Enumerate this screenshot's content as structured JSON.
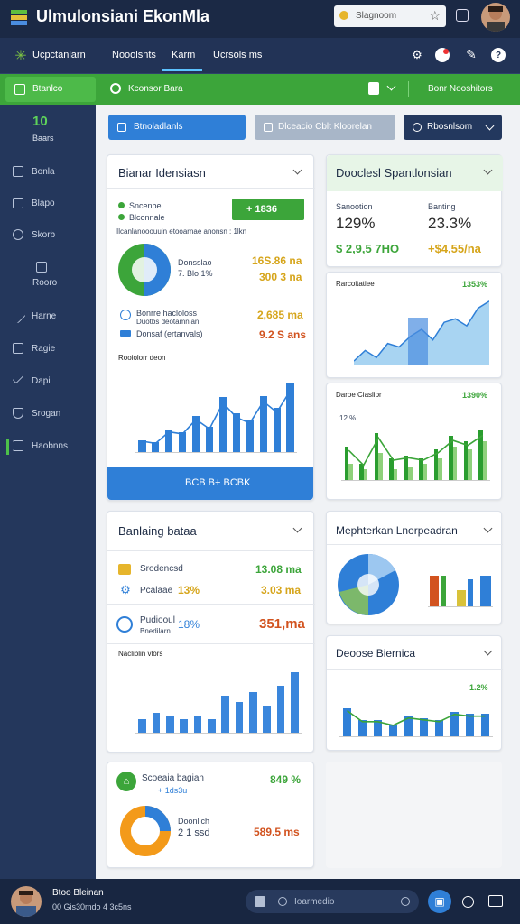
{
  "app": {
    "title": "Ulmulonsiani EkonMla",
    "search_text": "Slagnoom",
    "nav_tabs": [
      "Ucpctanlarn",
      "Nooolsnts",
      "Karm",
      "Ucrsols ms"
    ]
  },
  "greenbar": {
    "left_label": "Btanlco",
    "search_label": "Kconsor Bara",
    "right_label": "Bonr Nooshitors"
  },
  "sidebar": {
    "stat_value": "10",
    "stat_label": "Baars",
    "items": [
      {
        "label": "Bonla",
        "icon": "square-icon"
      },
      {
        "label": "Blapo",
        "icon": "hand-icon"
      },
      {
        "label": "Skorb",
        "icon": "refresh-icon"
      },
      {
        "label": "Rooro",
        "icon": "image-icon"
      },
      {
        "label": "Harne",
        "icon": "pencil-icon"
      },
      {
        "label": "Ragie",
        "icon": "table-icon"
      },
      {
        "label": "Dapi",
        "icon": "check-icon"
      },
      {
        "label": "Srogan",
        "icon": "shield-icon"
      },
      {
        "label": "Haobnns",
        "icon": "list-icon"
      }
    ]
  },
  "buttons": {
    "btn1": "Btnoladlanls",
    "btn2": "Dlceacio Cblt Kloorelan",
    "btn3": "Rbosnlsom"
  },
  "card1": {
    "title": "Bianar Idensiasn",
    "legend1": "Sncenbe",
    "legend2": "Blconnale",
    "badge": "+ 1836",
    "caption": "Ilcanlanooouuin etooarnae anonsn : 1lkn",
    "pie_label1": "Donsslao",
    "pie_label2": "7. Blo 1%",
    "pie_val1": "16S.86 na",
    "pie_val2": "300 3 na",
    "row1_label": "Bonrre hacloloss",
    "row1_sub": "Duotbs deotamnlan",
    "row1_val": "2,685 ma",
    "row2_label": "Donsaf (ertanvals)",
    "row2_val": "9.2 S ans",
    "chart_title": "Rooiolorr deon",
    "button": "BCB B+ BCBK"
  },
  "card2": {
    "title": "Dooclesl Spantlonsian",
    "col1_label": "Sanootion",
    "col2_label": "Banting",
    "col1_pct": "129%",
    "col2_pct": "23.3%",
    "col1_val": "$ 2,9,5 7HO",
    "col2_val": "+$4,55/na"
  },
  "card3": {
    "title": "Rarcoitatiee",
    "badge": "1353%"
  },
  "card4": {
    "title": "Daroe Ciaslior",
    "badge": "1390%",
    "ylabel": "12.%"
  },
  "card5": {
    "title": "Banlaing bataa",
    "row1_label": "Srodencsd",
    "row1_val": "13.08 ma",
    "row2_label": "Pcalaae",
    "row2_pct": "13%",
    "row2_val": "3.03 ma",
    "row3_label": "Pudiooul",
    "row3_sub": "Bnedilarn",
    "row3_pct": "18%",
    "row3_val": "351,ma",
    "chart_title": "Nacliblin vlors"
  },
  "card6": {
    "title": "Mephterkan Lnorpeadran"
  },
  "card7": {
    "title": "Deoose Biernica",
    "pct": "1.2%"
  },
  "card8": {
    "title": "Scoeaia bagian",
    "sub": "+ 1ds3u",
    "pie_label1": "Doonlich",
    "pie_label2": "2 1 ssd",
    "val": "589.5 ms",
    "badge": "849 %"
  },
  "footer": {
    "user_name": "Btoo Bleinan",
    "user_sub": "00 Gis30mdo 4 3c5ns",
    "search_placeholder": "Ioarmedio"
  },
  "colors": {
    "accent": "#3ca53a",
    "primary": "#2f7fd7",
    "sidebar": "#24375c"
  },
  "chart_data": [
    {
      "type": "bar",
      "title": "Rooiolorr deon",
      "series": [
        {
          "values": [
            15,
            12,
            28,
            25,
            45,
            32,
            68,
            48,
            40,
            70,
            55,
            85
          ]
        }
      ],
      "ylim": [
        0,
        100
      ]
    },
    {
      "type": "area",
      "title": "Rarcoitatiee",
      "series": [
        {
          "values": [
            5,
            20,
            10,
            30,
            25,
            40,
            50,
            35,
            60,
            65,
            55,
            80,
            90
          ]
        }
      ],
      "ylim": [
        0,
        100
      ]
    },
    {
      "type": "bar",
      "title": "Daroe Ciaslior",
      "series": [
        {
          "values": [
            60,
            30,
            85,
            40,
            45,
            40,
            55,
            80,
            70,
            90
          ]
        },
        {
          "values": [
            30,
            20,
            50,
            20,
            25,
            30,
            40,
            60,
            55,
            70
          ]
        }
      ],
      "ylim": [
        0,
        100
      ]
    },
    {
      "type": "bar",
      "title": "Nacliblin vlors",
      "series": [
        {
          "values": [
            20,
            30,
            25,
            20,
            25,
            20,
            55,
            45,
            60,
            40,
            70,
            90
          ]
        }
      ],
      "ylim": [
        0,
        100
      ]
    },
    {
      "type": "pie",
      "title": "Bianar Idensiasn",
      "values": [
        60,
        40
      ]
    },
    {
      "type": "pie",
      "title": "Mephterkan Lnorpeadran",
      "values": [
        70,
        20,
        10
      ]
    },
    {
      "type": "pie",
      "title": "Scoeaia bagian",
      "values": [
        75,
        25
      ]
    }
  ]
}
